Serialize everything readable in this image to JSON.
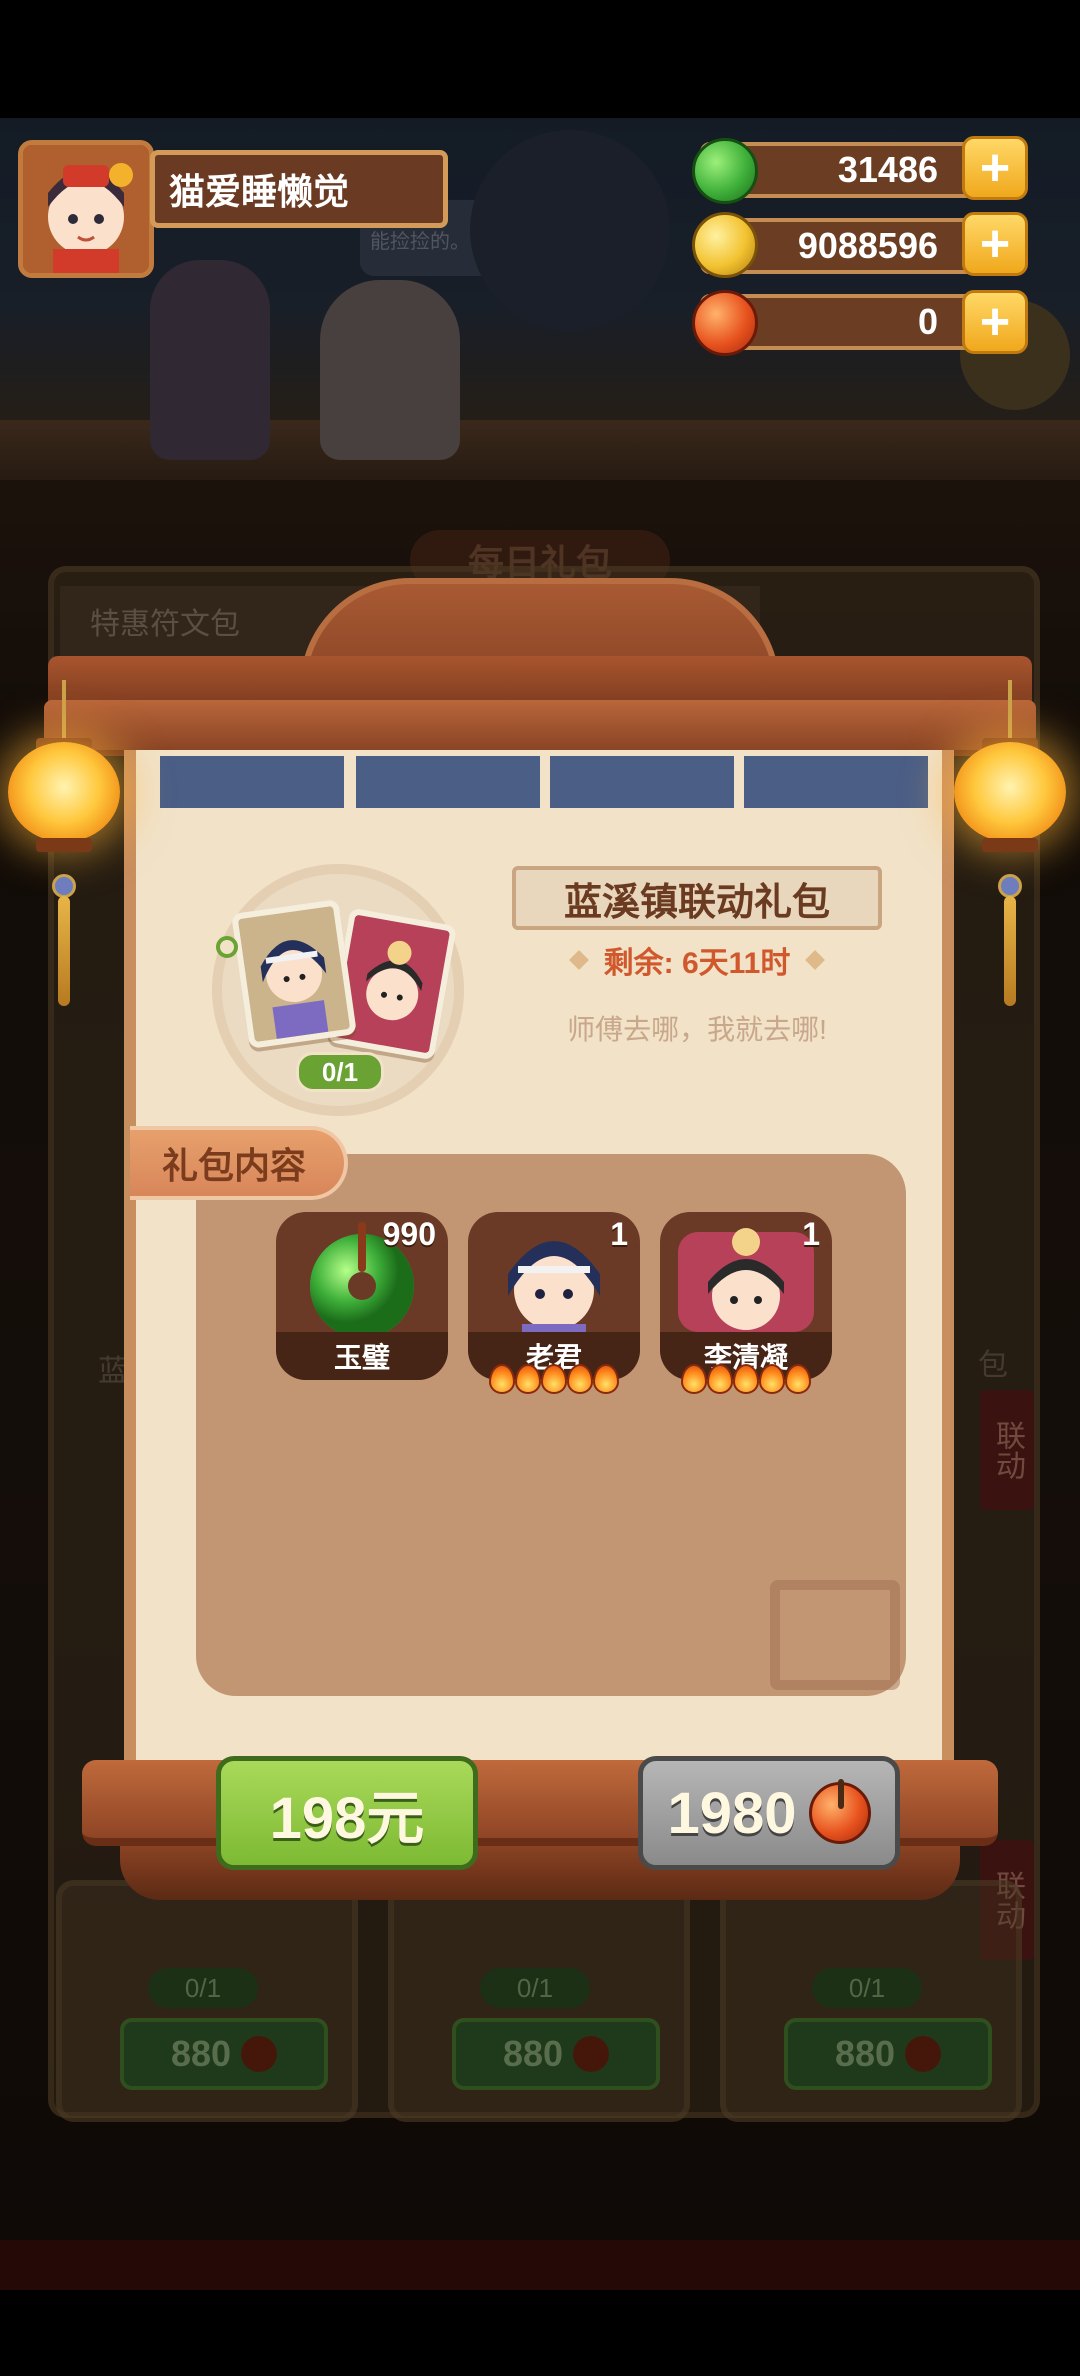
{
  "player": {
    "name": "猫爱睡懒觉"
  },
  "resources": [
    {
      "name": "jade",
      "value": "31486",
      "color": "#3fb03a"
    },
    {
      "name": "gold-coin",
      "value": "9088596",
      "color": "#f2c230"
    },
    {
      "name": "red-gem",
      "value": "0",
      "color": "#e8531f"
    }
  ],
  "background": {
    "speech_bubble": "路上\n能捡捡的。",
    "tab_title": "每日礼包",
    "section_label": "特惠符文包",
    "side_tab_1": "联动",
    "side_tab_2": "联动",
    "side_tab_3": "包",
    "side_tab_4": "蓝",
    "bottom_cards": [
      {
        "progress": "0/1",
        "price": "880"
      },
      {
        "progress": "0/1",
        "price": "880"
      },
      {
        "progress": "0/1",
        "price": "880"
      }
    ]
  },
  "pack": {
    "title": "蓝溪镇联动礼包",
    "timer": "剩余: 6天11时",
    "description": "师傅去哪，我就去哪!",
    "progress": "0/1"
  },
  "contents": {
    "label": "礼包内容",
    "items": [
      {
        "name": "玉璧",
        "count": "990",
        "stars": 0
      },
      {
        "name": "老君",
        "count": "1",
        "stars": 5
      },
      {
        "name": "李清凝",
        "count": "1",
        "stars": 5
      }
    ]
  },
  "buttons": {
    "cash": "198元",
    "gem": "1980"
  }
}
